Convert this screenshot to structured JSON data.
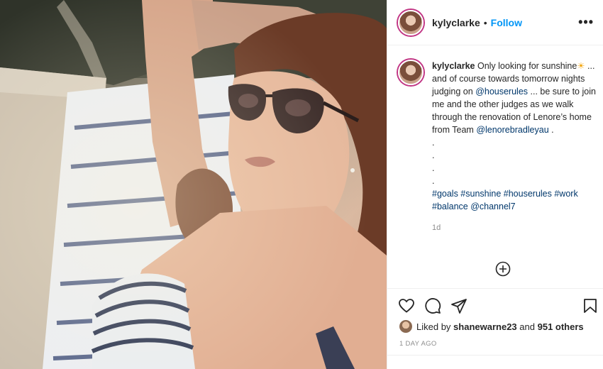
{
  "post": {
    "username": "kylyclarke",
    "separator": "•",
    "follow_label": "Follow",
    "more_label": "•••"
  },
  "caption": {
    "username": "kylyclarke",
    "text_1": "Only looking for sunshine",
    "sun_emoji": "☀",
    "text_2": "... and of course towards tomorrow nights judging on",
    "mention_1": "@houserules",
    "text_3": "... be sure to join me and the other judges as we walk through the renovation of Lenore’s home from Team",
    "mention_2": "@lenorebradleyau",
    "text_4": ".",
    "dots": [
      ".",
      ".",
      ".",
      "."
    ],
    "hashtags": "#goals #sunshine #houserules #work #balance @channel7",
    "age": "1d"
  },
  "icons": {
    "add_comment": "plus-circle-icon",
    "like": "heart-icon",
    "comment": "comment-icon",
    "share": "paper-plane-icon",
    "save": "bookmark-icon"
  },
  "likes": {
    "prefix": "Liked by",
    "user": "shanewarne23",
    "middle": "and",
    "others": "951 others"
  },
  "time_ago": "1 DAY AGO",
  "colors": {
    "link_blue": "#0095f6",
    "mention": "#00376b",
    "muted": "#8e8e8e",
    "text": "#262626"
  }
}
